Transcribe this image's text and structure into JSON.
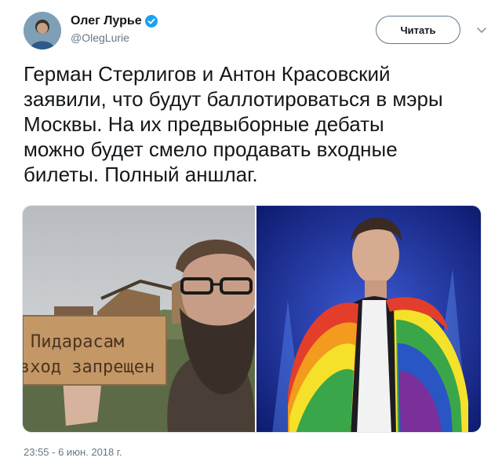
{
  "author": {
    "display_name": "Олег Лурье",
    "handle": "@OlegLurie",
    "verified": true
  },
  "actions": {
    "follow_label": "Читать",
    "more_icon": "chevron-down-icon"
  },
  "tweet": {
    "text": "Герман Стерлигов и Антон Красовский\nзаявили, что будут баллотироваться в мэры\nМосквы. На их предвыборные дебаты\nможно будет смело продавать входные\nбилеты. Полный аншлаг.",
    "timestamp": "23:55 - 6 июн. 2018 г."
  },
  "media": {
    "left_photo": {
      "sign_line_1": "Пидарасам",
      "sign_line_2": "вход запрещен"
    },
    "right_photo": {}
  },
  "colors": {
    "text": "#14171a",
    "secondary": "#657786",
    "verified_blue": "#1da1f2"
  }
}
